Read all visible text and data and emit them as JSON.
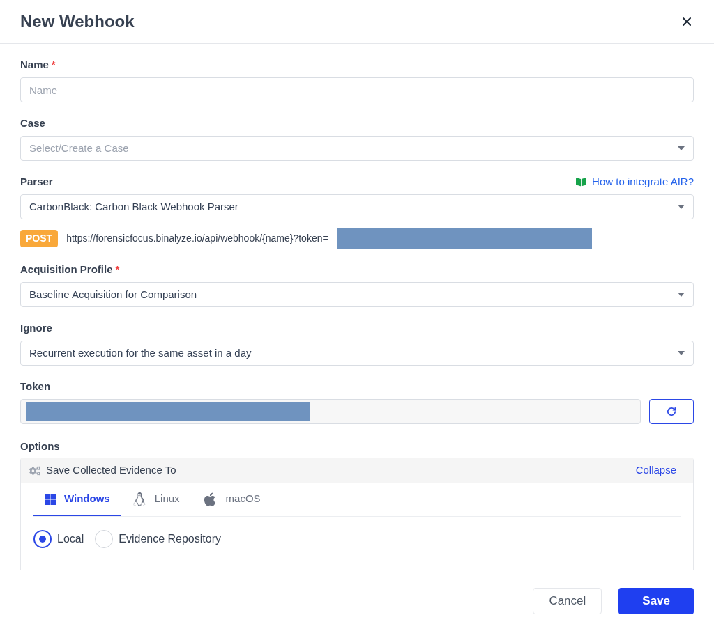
{
  "dialog": {
    "title": "New Webhook"
  },
  "fields": [
    {
      "kind": "input",
      "label": "Name",
      "required_mark": "*",
      "placeholder": "Name"
    },
    {
      "kind": "select",
      "label": "Case",
      "placeholder": "Select/Create a Case"
    },
    {
      "kind": "select",
      "label": "Parser",
      "value": "CarbonBlack: Carbon Black Webhook Parser",
      "help_link": "How to integrate AIR?"
    },
    {
      "kind": "url",
      "method": "POST",
      "url": "https://forensicfocus.binalyze.io/api/webhook/{name}?token="
    },
    {
      "kind": "select",
      "label": "Acquisition Profile",
      "required_mark": "*",
      "value": "Baseline Acquisition for Comparison"
    },
    {
      "kind": "select",
      "label": "Ignore",
      "value": "Recurrent execution for the same asset in a day"
    },
    {
      "kind": "token",
      "label": "Token"
    }
  ],
  "options": {
    "label": "Options",
    "panel_title": "Save Collected Evidence To",
    "collapse_link": "Collapse",
    "tabs": [
      {
        "label": "Windows",
        "kind": "windows",
        "selected": true
      },
      {
        "label": "Linux",
        "kind": "linux",
        "selected": false
      },
      {
        "label": "macOS",
        "kind": "apple",
        "selected": false
      }
    ],
    "radios": [
      {
        "label": "Local",
        "selected": true
      },
      {
        "label": "Evidence Repository",
        "selected": false
      }
    ]
  },
  "buttons": [
    {
      "label": "Cancel",
      "kind": "secondary"
    },
    {
      "label": "Save",
      "kind": "primary"
    }
  ]
}
